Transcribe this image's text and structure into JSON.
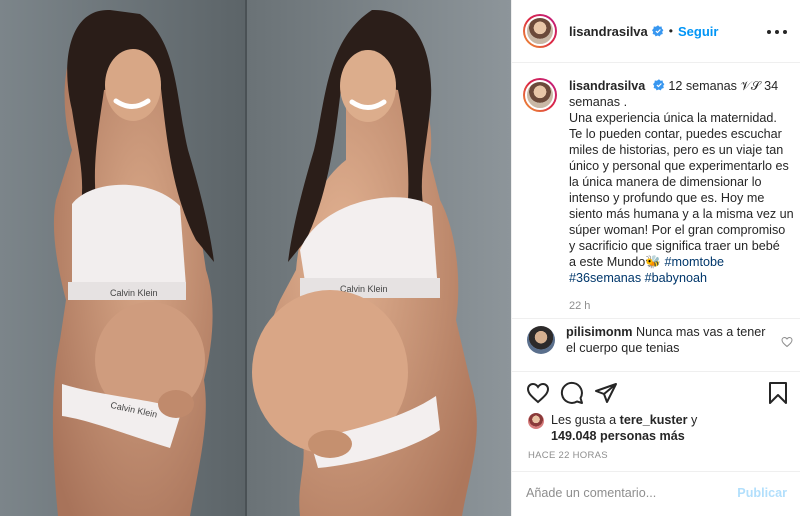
{
  "post": {
    "author": "lisandrasilva",
    "follow_label": "Seguir",
    "dot": "•"
  },
  "caption": {
    "user": "lisandrasilva",
    "lines": [
      "12 semanas 𝒱𝒮 34",
      "semanas .",
      "Una experiencia única la maternidad.",
      "Te lo pueden contar, puedes escuchar",
      "miles de historias, pero es un viaje tan",
      "único y personal que experimentarlo es",
      "la única manera de dimensionar lo",
      "intenso y profundo que es. Hoy me",
      "siento más humana y a la misma vez un",
      "súper woman! Por el gran compromiso",
      "y sacrificio que significa traer un bebé",
      "a este Mundo🐝"
    ],
    "tag_momtobe": "#momtobe",
    "tag_36semanas": "#36semanas",
    "tag_babynoah": "#babynoah",
    "time": "22 h"
  },
  "comment": {
    "user": "pilisimonm",
    "text_1": "Nunca mas vas a tener",
    "text_2": "el cuerpo que tenias"
  },
  "likes": {
    "prefix": "Les gusta a",
    "user": "tere_kuster",
    "conj": "y",
    "count": "149.048 personas más"
  },
  "timestamp": "HACE 22 HORAS",
  "add_comment": {
    "placeholder": "Añade un comentario...",
    "publish": "Publicar"
  },
  "photo": {
    "brand_left": "Calvin Klein",
    "brand_right": "Calvin Klein",
    "brand_left_bottom": "Calvin Klein"
  },
  "colors": {
    "accent": "#0095f6",
    "publish_disabled": "#b2dffc",
    "hashtag": "#00376b",
    "muted": "#8e8e8e"
  },
  "icons": [
    "verified-badge-icon",
    "more-options-icon",
    "heart-icon",
    "comment-icon",
    "share-icon",
    "bookmark-icon",
    "like-comment-heart-icon"
  ]
}
